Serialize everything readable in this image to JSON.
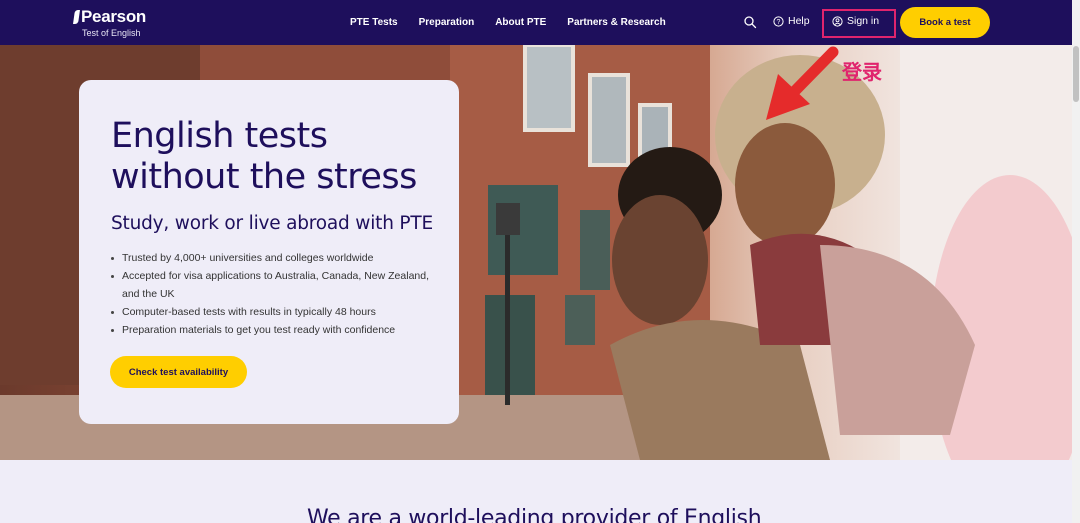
{
  "header": {
    "logo_title": "Pearson",
    "logo_subtitle": "Test of English",
    "nav": [
      "PTE Tests",
      "Preparation",
      "About PTE",
      "Partners & Research"
    ],
    "help_label": "Help",
    "signin_label": "Sign in",
    "book_label": "Book a test",
    "bg_color": "#1e0f5c",
    "accent_color": "#ffce00"
  },
  "annotation": {
    "label": "登录",
    "color": "#e0246d"
  },
  "hero": {
    "title_line1": "English tests",
    "title_line2": "without the stress",
    "subtitle": "Study, work or live abroad with PTE",
    "bullets": [
      "Trusted by 4,000+ universities and colleges worldwide",
      "Accepted for visa applications to Australia, Canada, New Zealand, and the UK",
      "Computer-based tests with results in typically 48 hours",
      "Preparation materials to get you test ready with confidence"
    ],
    "cta_label": "Check test availability"
  },
  "lower": {
    "heading": "We are a world-leading provider of English"
  }
}
